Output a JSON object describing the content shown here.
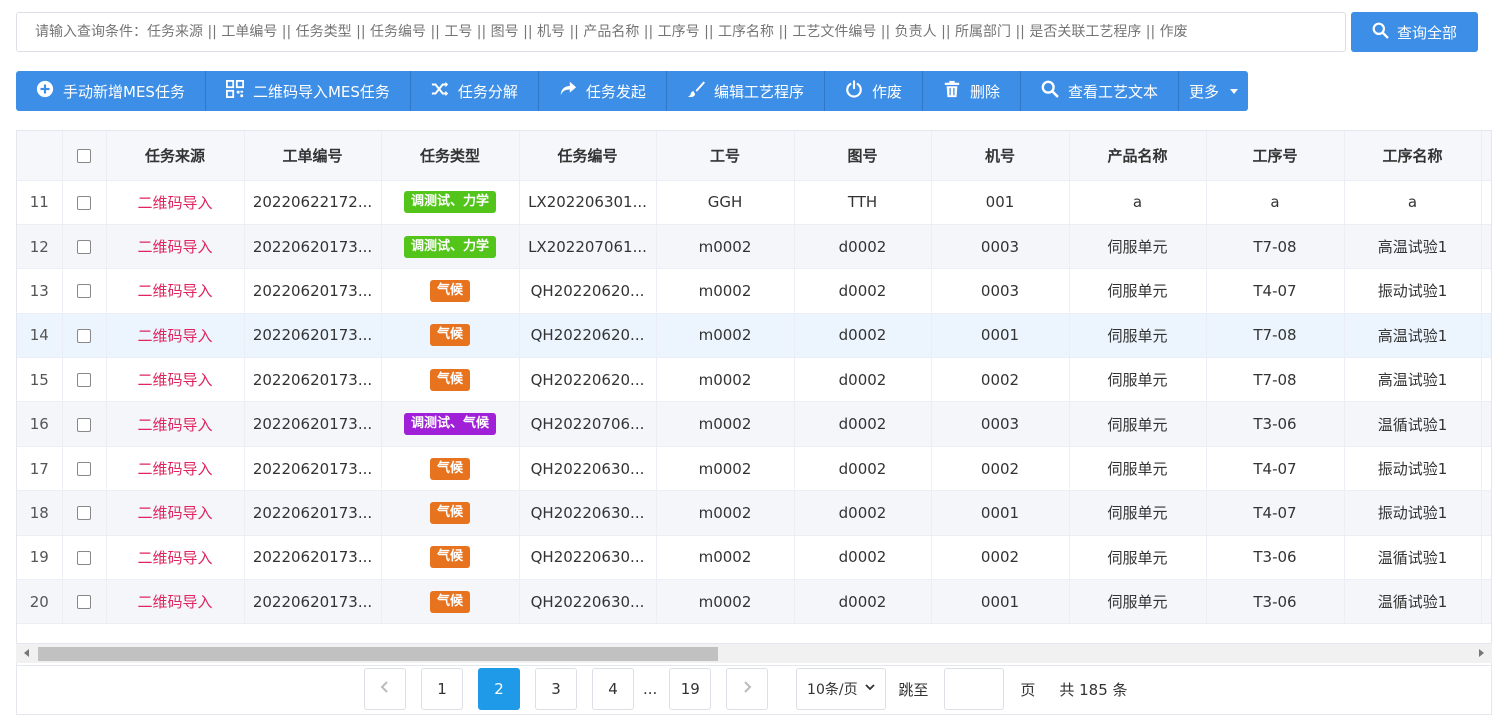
{
  "search": {
    "placeholder": "请输入查询条件：任务来源 || 工单编号 || 任务类型 || 任务编号 || 工号 || 图号 || 机号 || 产品名称 || 工序号 || 工序名称 || 工艺文件编号 || 负责人 || 所属部门 || 是否关联工艺程序 || 作废",
    "button_label": "查询全部"
  },
  "toolbar": {
    "buttons": [
      {
        "label": "手动新增MES任务",
        "icon": "plus-circle-icon"
      },
      {
        "label": "二维码导入MES任务",
        "icon": "qrcode-icon"
      },
      {
        "label": "任务分解",
        "icon": "shuffle-icon"
      },
      {
        "label": "任务发起",
        "icon": "share-arrow-icon"
      },
      {
        "label": "编辑工艺程序",
        "icon": "brush-icon"
      },
      {
        "label": "作废",
        "icon": "power-icon"
      },
      {
        "label": "删除",
        "icon": "trash-icon"
      },
      {
        "label": "查看工艺文本",
        "icon": "search-icon"
      },
      {
        "label": "更多",
        "icon": "caret-down-icon"
      }
    ]
  },
  "table": {
    "headers": [
      "任务来源",
      "工单编号",
      "任务类型",
      "任务编号",
      "工号",
      "图号",
      "机号",
      "产品名称",
      "工序号",
      "工序名称"
    ],
    "rows": [
      {
        "idx": "11",
        "source": "二维码导入",
        "order": "20220622172...",
        "type": "调测试、力学",
        "type_color": "#52c41a",
        "task": "LX202206301...",
        "job": "GGH",
        "drawing": "TTH",
        "machine": "001",
        "product": "a",
        "proc_no": "a",
        "proc_name": "a"
      },
      {
        "idx": "12",
        "source": "二维码导入",
        "order": "20220620173...",
        "type": "调测试、力学",
        "type_color": "#52c41a",
        "task": "LX202207061...",
        "job": "m0002",
        "drawing": "d0002",
        "machine": "0003",
        "product": "伺服单元",
        "proc_no": "T7-08",
        "proc_name": "高温试验1"
      },
      {
        "idx": "13",
        "source": "二维码导入",
        "order": "20220620173...",
        "type": "气候",
        "type_color": "#e8731f",
        "task": "QH20220620...",
        "job": "m0002",
        "drawing": "d0002",
        "machine": "0003",
        "product": "伺服单元",
        "proc_no": "T4-07",
        "proc_name": "振动试验1"
      },
      {
        "idx": "14",
        "source": "二维码导入",
        "order": "20220620173...",
        "type": "气候",
        "type_color": "#e8731f",
        "task": "QH20220620...",
        "job": "m0002",
        "drawing": "d0002",
        "machine": "0001",
        "product": "伺服单元",
        "proc_no": "T7-08",
        "proc_name": "高温试验1"
      },
      {
        "idx": "15",
        "source": "二维码导入",
        "order": "20220620173...",
        "type": "气候",
        "type_color": "#e8731f",
        "task": "QH20220620...",
        "job": "m0002",
        "drawing": "d0002",
        "machine": "0002",
        "product": "伺服单元",
        "proc_no": "T7-08",
        "proc_name": "高温试验1"
      },
      {
        "idx": "16",
        "source": "二维码导入",
        "order": "20220620173...",
        "type": "调测试、气候",
        "type_color": "#a020d8",
        "task": "QH20220706...",
        "job": "m0002",
        "drawing": "d0002",
        "machine": "0003",
        "product": "伺服单元",
        "proc_no": "T3-06",
        "proc_name": "温循试验1"
      },
      {
        "idx": "17",
        "source": "二维码导入",
        "order": "20220620173...",
        "type": "气候",
        "type_color": "#e8731f",
        "task": "QH20220630...",
        "job": "m0002",
        "drawing": "d0002",
        "machine": "0002",
        "product": "伺服单元",
        "proc_no": "T4-07",
        "proc_name": "振动试验1"
      },
      {
        "idx": "18",
        "source": "二维码导入",
        "order": "20220620173...",
        "type": "气候",
        "type_color": "#e8731f",
        "task": "QH20220630...",
        "job": "m0002",
        "drawing": "d0002",
        "machine": "0001",
        "product": "伺服单元",
        "proc_no": "T4-07",
        "proc_name": "振动试验1"
      },
      {
        "idx": "19",
        "source": "二维码导入",
        "order": "20220620173...",
        "type": "气候",
        "type_color": "#e8731f",
        "task": "QH20220630...",
        "job": "m0002",
        "drawing": "d0002",
        "machine": "0002",
        "product": "伺服单元",
        "proc_no": "T3-06",
        "proc_name": "温循试验1"
      },
      {
        "idx": "20",
        "source": "二维码导入",
        "order": "20220620173...",
        "type": "气候",
        "type_color": "#e8731f",
        "task": "QH20220630...",
        "job": "m0002",
        "drawing": "d0002",
        "machine": "0001",
        "product": "伺服单元",
        "proc_no": "T3-06",
        "proc_name": "温循试验1"
      }
    ]
  },
  "pagination": {
    "pages": [
      "1",
      "2",
      "3",
      "4",
      "19"
    ],
    "current": "2",
    "ellipsis": "...",
    "page_size": "10条/页",
    "jump_label": "跳至",
    "unit_label": "页",
    "total_label": "共 185 条"
  },
  "colors": {
    "primary": "#3d8ee6",
    "active_page": "#1f9ae8",
    "source_text": "#e0245e"
  }
}
